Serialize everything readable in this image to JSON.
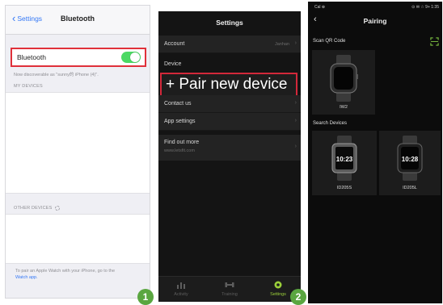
{
  "screen1": {
    "nav_back_label": "Settings",
    "nav_title": "Bluetooth",
    "bluetooth_label": "Bluetooth",
    "bluetooth_on": true,
    "discoverable_text": "Now discoverable as \"sunny的 iPhone (4)\".",
    "my_devices_header": "MY DEVICES",
    "other_devices_header": "OTHER DEVICES",
    "footer_text": "To pair an Apple Watch with your iPhone, go to the",
    "footer_link": "Watch app.",
    "colors": {
      "accent": "#3478f6",
      "toggle": "#4cd964",
      "highlight": "#e0303a"
    }
  },
  "badge1": "1",
  "screen2": {
    "title": "Settings",
    "account_label": "Account",
    "account_value": "Janhan",
    "device_section": "Device",
    "pair_label": "+ Pair new device",
    "contact_label": "Contact us",
    "app_settings_label": "App settings",
    "find_label": "Find out more",
    "find_sub": "www.letsfit.com",
    "tabs": [
      {
        "label": "Activity",
        "icon": "bar-chart-icon"
      },
      {
        "label": "Training",
        "icon": "dumbbell-icon"
      },
      {
        "label": "Settings",
        "icon": "gear-icon"
      }
    ],
    "colors": {
      "highlight": "#d2283a",
      "active_tab": "#9bcf3a"
    }
  },
  "badge2": "2",
  "screen3": {
    "status_left": "Cal ⊕",
    "status_right": "⊙ ✉ ☆ 9+ 1:35",
    "title": "Pairing",
    "scan_label": "Scan QR Code",
    "scan_icon": "scan-icon",
    "qr_device": {
      "name": "IW2"
    },
    "search_label": "Search Devices",
    "devices": [
      {
        "name": "ID205S",
        "time": "10:23"
      },
      {
        "name": "ID205L",
        "time": "10:28"
      }
    ]
  }
}
